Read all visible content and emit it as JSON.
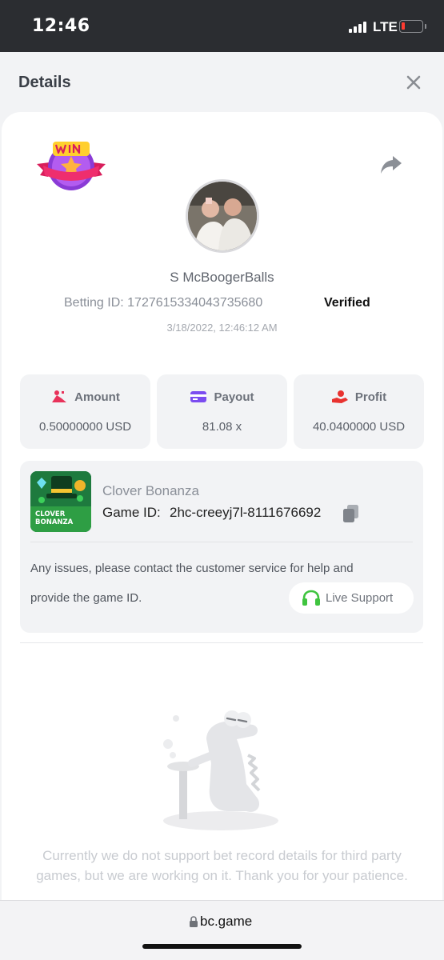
{
  "status_bar": {
    "time": "12:46",
    "network": "LTE",
    "battery_level": 0.1,
    "battery_color": "#ff3b30"
  },
  "header": {
    "title": "Details",
    "close_icon": "close-icon"
  },
  "bet": {
    "badge_icon": "win-badge-icon",
    "share_icon": "share-icon",
    "user_name": "S McBoogerBalls",
    "betting_id": "Betting ID: 1727615334043735680",
    "verified": "Verified",
    "timestamp": "3/18/2022, 12:46:12 AM"
  },
  "stats": [
    {
      "icon": "amount-icon",
      "label": "Amount",
      "value": "0.50000000 USD"
    },
    {
      "icon": "payout-icon",
      "label": "Payout",
      "value": "81.08 x"
    },
    {
      "icon": "profit-icon",
      "label": "Profit",
      "value": "40.0400000 USD"
    }
  ],
  "game": {
    "thumb_text": "CLOVER BONANZA",
    "name": "Clover Bonanza",
    "id_label": "Game ID:",
    "id_value": "2hc-creeyj7l-8111676692",
    "copy_icon": "copy-icon",
    "issue_line_1": "Any issues, please contact the customer service for help and",
    "issue_line_2": "provide the game ID.",
    "support_label": "Live Support",
    "support_icon": "headset-icon"
  },
  "notice": {
    "text": "Currently we do not support bet record details for third party games, but we are working on it. Thank you for your patience."
  },
  "browser": {
    "url": "bc.game",
    "lock_icon": "lock-icon"
  },
  "colors": {
    "accent_green": "#3fc43f",
    "amount_icon": "#e8325a",
    "payout_icon": "#7b4cf0",
    "profit_icon": "#e8322f"
  }
}
